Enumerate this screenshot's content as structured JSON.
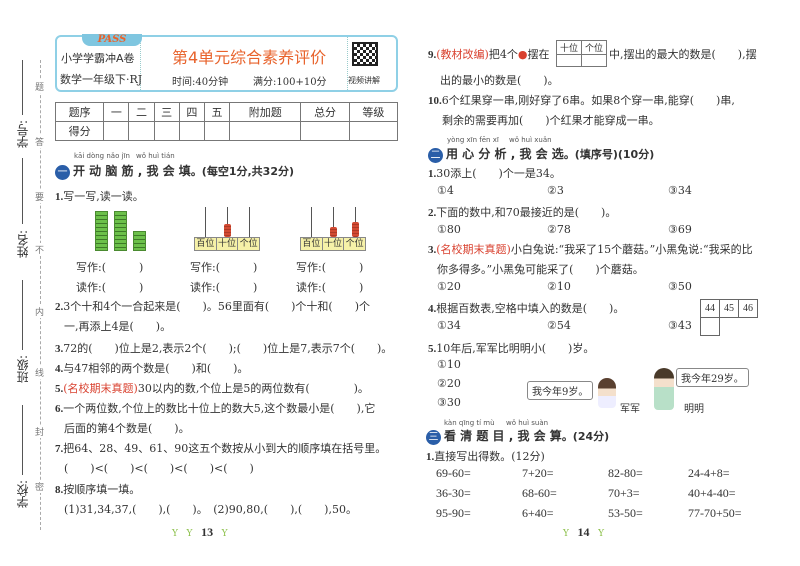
{
  "margin": {
    "fields": [
      "学号:",
      "姓名:",
      "班级:",
      "学校:"
    ],
    "fold_words": [
      "题",
      "答",
      "要",
      "不",
      "内",
      "线",
      "封",
      "密"
    ]
  },
  "header": {
    "logo": "PASS",
    "series": "小学学霸冲A卷",
    "subject": "数学一年级下·RJ",
    "title": "第4单元综合素养评价",
    "time": "时间:40分钟",
    "full_score": "满分:100+10分",
    "qr_label": "视频讲解"
  },
  "score_table": {
    "headers": [
      "题序",
      "一",
      "二",
      "三",
      "四",
      "五",
      "附加题",
      "总分",
      "等级"
    ],
    "row_label": "得分"
  },
  "left": {
    "section1": {
      "badge": "一",
      "pinyin1": "kāi dòng nǎo jīn",
      "pinyin2": "wǒ huì tián",
      "title": "开 动 脑 筋 , 我 会 填",
      "note": "。(每空1分,共32分)"
    },
    "q1": {
      "num": "1.",
      "text": "写一写,读一读。",
      "abacus_labels": [
        "百位",
        "十位",
        "个位"
      ],
      "write": "写作:(　　　)",
      "read": "读作:(　　　)"
    },
    "q2": {
      "num": "2.",
      "text": "3个十和4个一合起来是(　　)。56里面有(　　)个十和(　　)个",
      "text2": "一,再添上4是(　　)。"
    },
    "q3": {
      "num": "3.",
      "text": "72的(　　)位上是2,表示2个(　　);(　　)位上是7,表示7个(　　)。"
    },
    "q4": {
      "num": "4.",
      "text": "与47相邻的两个数是(　　)和(　　)。"
    },
    "q5": {
      "num": "5.",
      "tag": "(名校期末真题)",
      "text": "30以内的数,个位上是5的两位数有(　　　　)。"
    },
    "q6": {
      "num": "6.",
      "text": "一个两位数,个位上的数比十位上的数大5,这个数最小是(　　),它",
      "text2": "后面的第4个数是(　　)。"
    },
    "q7": {
      "num": "7.",
      "text": "把64、28、49、61、90这五个数按从小到大的顺序填在括号里。",
      "text2": "(　　)<(　　)<(　　)<(　　)<(　　)"
    },
    "q8": {
      "num": "8.",
      "text": "按顺序填一填。",
      "text2": "(1)31,34,37,(　　),(　　)。　(2)90,80,(　　),(　　),50。"
    },
    "page": "13"
  },
  "right": {
    "q9": {
      "num": "9.",
      "tag": "(教材改编)",
      "text_a": "把4个",
      "text_b": "摆在",
      "place_labels": [
        "十位",
        "个位"
      ],
      "text_c": "中,摆出的最大的数是(　　),摆",
      "text2": "出的最小的数是(　　)。"
    },
    "q10": {
      "num": "10.",
      "text": "6个红果穿一串,刚好穿了6串。如果8个穿一串,能穿(　　)串,",
      "text2": "剩余的需要再加(　　)个红果才能穿成一串。"
    },
    "section2": {
      "badge": "二",
      "pinyin1": "yòng xīn fēn xī",
      "pinyin2": "wǒ huì xuǎn",
      "title": "用 心 分 析 , 我 会 选",
      "note": "。(填序号)(10分)"
    },
    "c1": {
      "num": "1.",
      "text": "30添上(　　)个一是34。",
      "options": [
        "①4",
        "②3",
        "③34"
      ]
    },
    "c2": {
      "num": "2.",
      "text": "下面的数中,和70最接近的是(　　)。",
      "options": [
        "①80",
        "②78",
        "③69"
      ]
    },
    "c3": {
      "num": "3.",
      "tag": "(名校期末真题)",
      "text": "小白兔说:“我采了15个蘑菇。”小黑兔说:“我采的比",
      "text2": "你多得多。”小黑兔可能采了(　　)个蘑菇。",
      "options": [
        "①20",
        "②10",
        "③50"
      ]
    },
    "c4": {
      "num": "4.",
      "text": "根据百数表,空格中填入的数是(　　)。",
      "options": [
        "①34",
        "②54",
        "③43"
      ],
      "grid": [
        "44",
        "45",
        "46"
      ]
    },
    "c5": {
      "num": "5.",
      "text": "10年后,军军比明明小(　　)岁。",
      "options": [
        "①10",
        "②20",
        "③30"
      ],
      "bubble1": "我今年9岁。",
      "bubble2": "我今年29岁。",
      "name1": "军军",
      "name2": "明明"
    },
    "section3": {
      "badge": "三",
      "pinyin1": "kàn qīng tí mù",
      "pinyin2": "wǒ huì suàn",
      "title": "看 清 题 目 , 我 会 算",
      "note": "。(24分)"
    },
    "d1": {
      "num": "1.",
      "text": "直接写出得数。(12分)",
      "rows": [
        [
          "69-60=",
          "7+20=",
          "82-80=",
          "24-4+8="
        ],
        [
          "36-30=",
          "68-60=",
          "70+3=",
          "40+4-40="
        ],
        [
          "95-90=",
          "6+40=",
          "53-50=",
          "77-70+50="
        ]
      ]
    },
    "page": "14"
  },
  "colors": {
    "accent_red": "#d9412f",
    "badge_blue": "#2a5ea8",
    "header_border": "#8fd0e6"
  }
}
